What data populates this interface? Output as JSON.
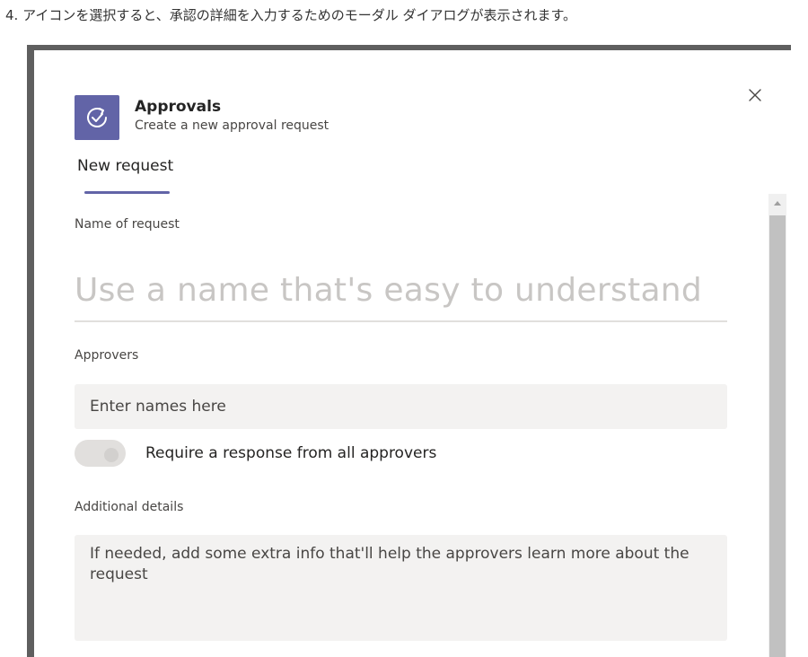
{
  "caption": "4. アイコンを選択すると、承認の詳細を入力するためのモーダル ダイアログが表示されます。",
  "dialog": {
    "app_title": "Approvals",
    "app_subtitle": "Create a new approval request",
    "app_icon": "approvals-check-icon",
    "close_icon": "close-icon",
    "accent_color": "#6264a7"
  },
  "tabs": [
    {
      "label": "New request",
      "selected": true
    }
  ],
  "form": {
    "name": {
      "label": "Name of request",
      "value": "",
      "placeholder": "Use a name that's easy to understand"
    },
    "approvers": {
      "label": "Approvers",
      "value": "",
      "placeholder": "Enter names here"
    },
    "require_all": {
      "label": "Require a response from all approvers",
      "on": false
    },
    "details": {
      "label": "Additional details",
      "value": "",
      "placeholder": "If needed, add some extra info that'll help the approvers learn more about the request"
    }
  }
}
